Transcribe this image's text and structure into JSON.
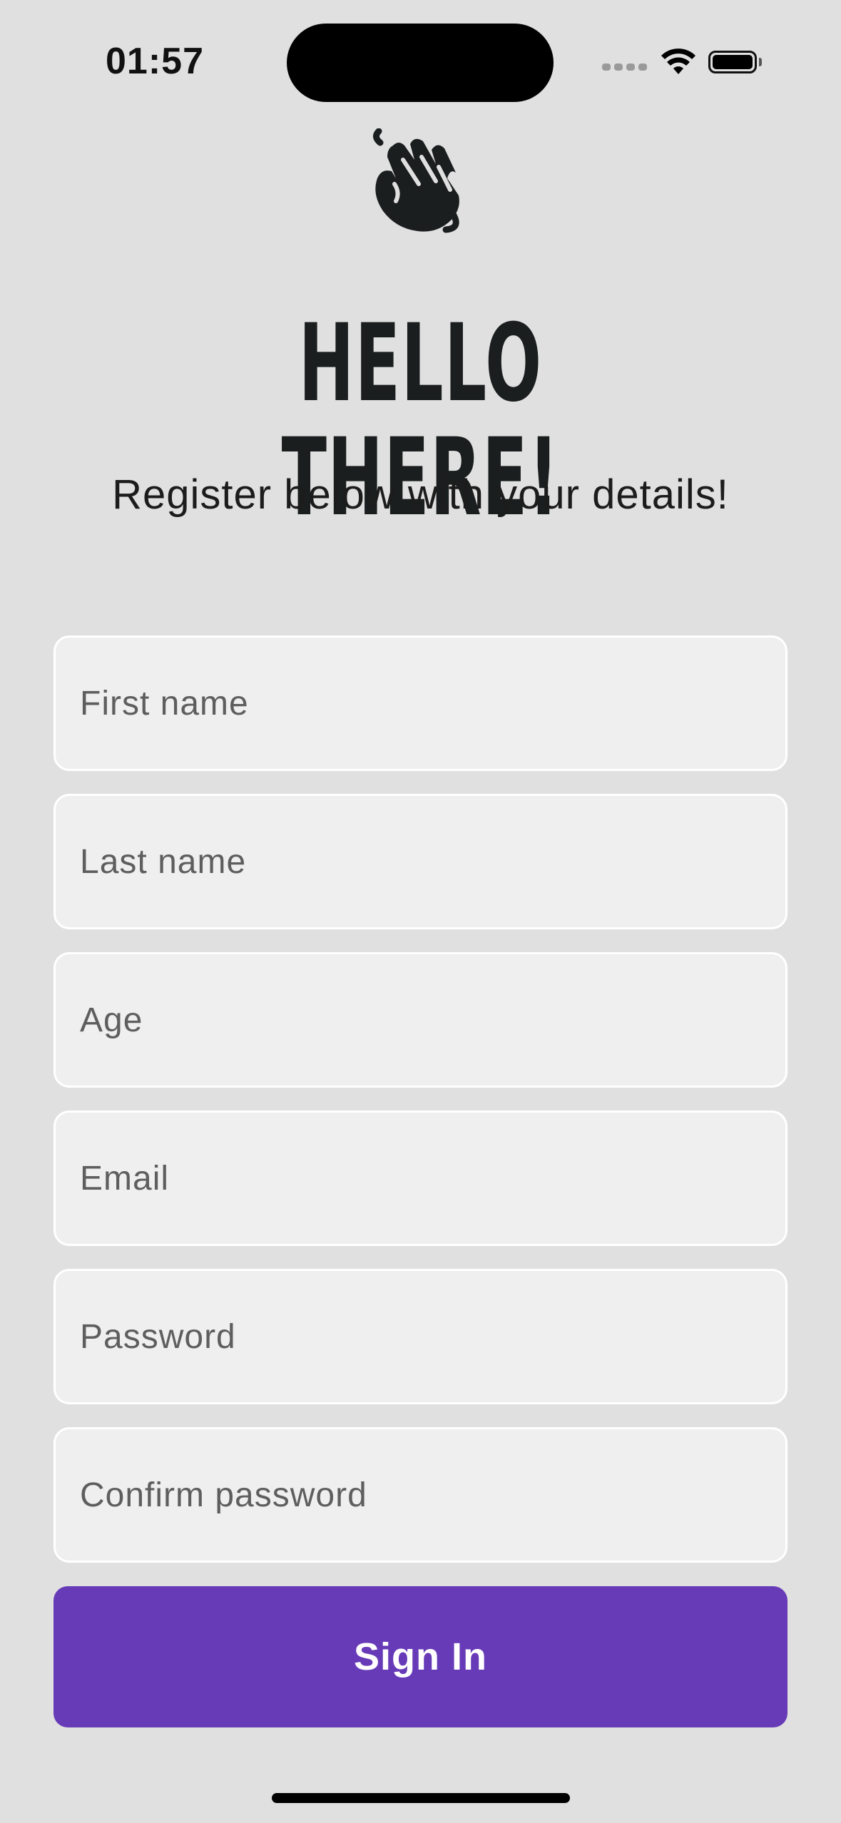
{
  "status_bar": {
    "time": "01:57",
    "icons": [
      "signal-icon",
      "wifi-icon",
      "battery-icon"
    ]
  },
  "logo": {
    "icon": "waving-hand-icon"
  },
  "header": {
    "title": "HELLO THERE!",
    "subtitle": "Register below with your details!"
  },
  "form": {
    "first_name": {
      "placeholder": "First name",
      "value": ""
    },
    "last_name": {
      "placeholder": "Last name",
      "value": ""
    },
    "age": {
      "placeholder": "Age",
      "value": ""
    },
    "email": {
      "placeholder": "Email",
      "value": ""
    },
    "password": {
      "placeholder": "Password",
      "value": ""
    },
    "confirm_password": {
      "placeholder": "Confirm password",
      "value": ""
    }
  },
  "actions": {
    "sign_in_label": "Sign In"
  },
  "colors": {
    "background": "#e0e0e0",
    "field_background": "#efefef",
    "field_border": "#ffffff",
    "primary_button": "#673ab7",
    "text_dark": "#1b1e1e"
  }
}
